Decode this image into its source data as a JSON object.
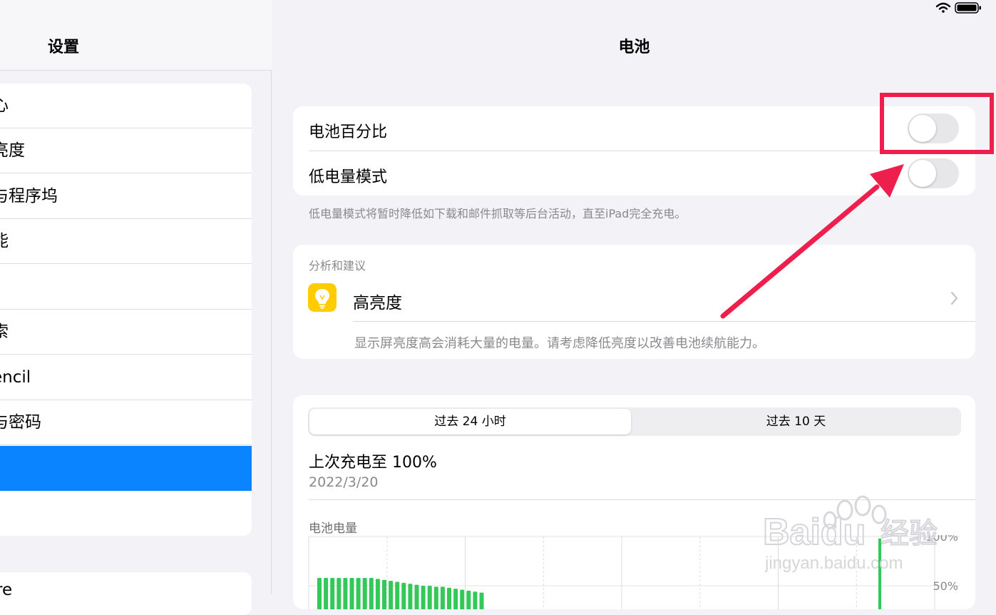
{
  "sidebar": {
    "title": "设置",
    "items": [
      {
        "label": "心"
      },
      {
        "label": "亮度"
      },
      {
        "label": "与程序坞"
      },
      {
        "label": "能"
      },
      {
        "label": ""
      },
      {
        "label": "索"
      },
      {
        "label": "encil"
      },
      {
        "label": "与密码"
      },
      {
        "label": ""
      },
      {
        "label": ""
      }
    ],
    "selected_index": 8,
    "next_group_item": "re"
  },
  "header": {
    "title": "电池"
  },
  "battery_settings": {
    "percentage_label": "电池百分比",
    "percentage_on": false,
    "low_power_label": "低电量模式",
    "low_power_on": false,
    "footer": "低电量模式将暂时降低如下载和邮件抓取等后台活动，直至iPad完全充电。"
  },
  "insights": {
    "section_title": "分析和建议",
    "item_title": "高亮度",
    "item_description": "显示屏亮度高会消耗大量的电量。请考虑降低亮度以改善电池续航能力。",
    "icon": "lightbulb-icon"
  },
  "usage": {
    "tabs": [
      {
        "label": "过去 24 小时",
        "selected": true
      },
      {
        "label": "过去 10 天",
        "selected": false
      }
    ],
    "last_charge_label": "上次充电至 100%",
    "last_charge_date": "2022/3/20"
  },
  "chart_data": {
    "type": "bar",
    "title": "电池电量",
    "ytick_labels": [
      "100%",
      "50%"
    ],
    "ylim": [
      0,
      100
    ],
    "values": [
      58,
      58,
      58,
      58,
      58,
      58,
      58,
      58,
      58,
      57,
      56,
      55,
      54,
      53,
      52,
      51,
      50,
      50,
      49,
      49,
      48,
      47,
      46,
      45,
      44,
      43
    ],
    "spike_value": 98,
    "color": "#34c759",
    "grid": true
  },
  "watermark": {
    "brand": "Baidu",
    "brand_cn": "经验",
    "url": "jingyan.baidu.com"
  },
  "colors": {
    "accent": "#0a84ff",
    "annotation": "#ee1e4d",
    "battery_green": "#34c759",
    "bulb_tile": "#ffcc00"
  }
}
